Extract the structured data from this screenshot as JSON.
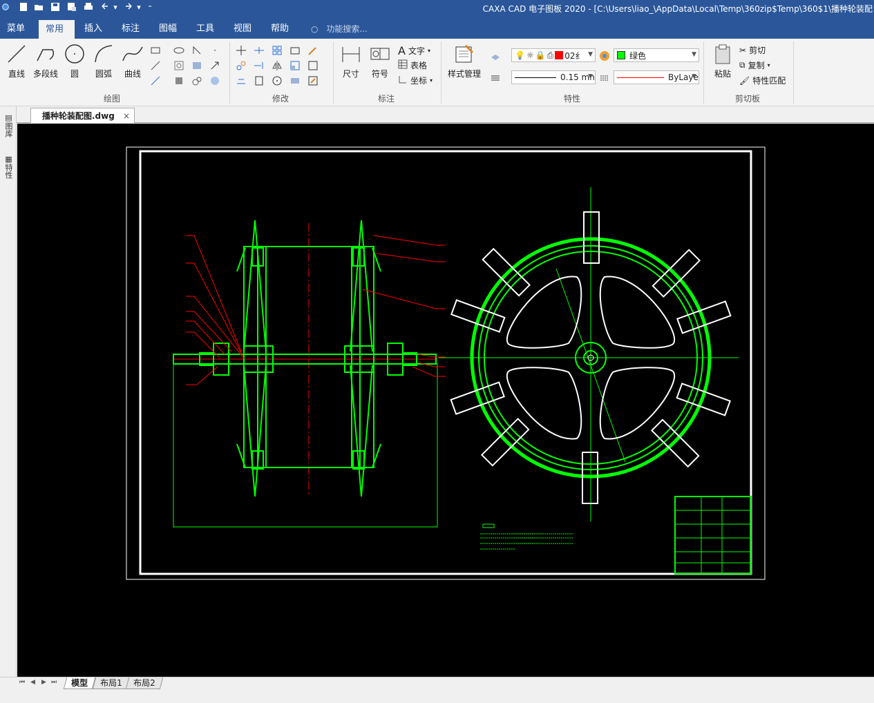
{
  "window": {
    "title": "CAXA CAD 电子图板 2020 - [C:\\Users\\liao_\\AppData\\Local\\Temp\\360zip$Temp\\360$1\\播种轮装配"
  },
  "menu_tabs": [
    {
      "label": "菜单"
    },
    {
      "label": "常用"
    },
    {
      "label": "插入"
    },
    {
      "label": "标注"
    },
    {
      "label": "图幅"
    },
    {
      "label": "工具"
    },
    {
      "label": "视图"
    },
    {
      "label": "帮助"
    }
  ],
  "search": {
    "placeholder": "功能搜索..."
  },
  "ribbon": {
    "draw": {
      "group_label": "绘图",
      "line": "直线",
      "polyline": "多段线",
      "circle": "圆",
      "arc": "圆弧",
      "curve": "曲线"
    },
    "modify": {
      "group_label": "修改"
    },
    "annotate": {
      "group_label": "标注",
      "dimension": "尺寸",
      "symbol": "符号",
      "text": "文字",
      "table": "表格",
      "coordinate": "坐标"
    },
    "properties": {
      "group_label": "特性",
      "style_manager": "样式管理",
      "layer_name": "02纟",
      "color_name": "绿色",
      "color_hex": "#00ff00",
      "linewidth": "0.15 mn",
      "linetype": "ByLaye"
    },
    "clipboard": {
      "group_label": "剪切板",
      "paste": "粘贴",
      "cut": "剪切",
      "copy": "复制",
      "match_props": "特性匹配"
    }
  },
  "document": {
    "tab_label": "播种轮装配图.dwg",
    "close_glyph": "×"
  },
  "side_panel": {
    "library": "图库",
    "properties": "特性"
  },
  "layout_tabs": [
    {
      "label": "模型",
      "active": true
    },
    {
      "label": "布局1",
      "active": false
    },
    {
      "label": "布局2",
      "active": false
    }
  ],
  "colors": {
    "accent": "#2b579a",
    "drawing_green": "#00ff00",
    "drawing_red": "#ff0000",
    "canvas_bg": "#000000"
  }
}
